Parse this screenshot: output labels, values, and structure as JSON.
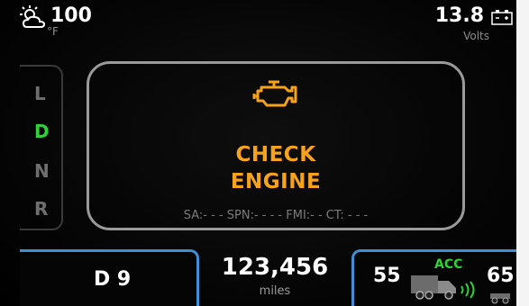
{
  "status_bar": {
    "weather_icon": "partly-cloudy-icon",
    "temperature": "100",
    "temperature_unit": "°F",
    "voltage": "13.8",
    "voltage_unit": "Volts",
    "battery_icon": "battery-icon"
  },
  "gear_selector": {
    "gears": [
      "L",
      "D",
      "N",
      "R"
    ],
    "active": "D",
    "active_color": "#31d13a"
  },
  "warning": {
    "icon": "check-engine-icon",
    "line1": "CHECK",
    "line2": "ENGINE",
    "color": "#f7a21b",
    "codes": "SA:- - - SPN:- - - - FMI:- - CT: - - -"
  },
  "bottom": {
    "gear_range": "D 9",
    "odometer": "123,456",
    "odometer_unit": "miles",
    "acc_label": "ACC",
    "vehicle_speed": "55",
    "set_speed": "65",
    "accent_color": "#3f8fd6"
  }
}
